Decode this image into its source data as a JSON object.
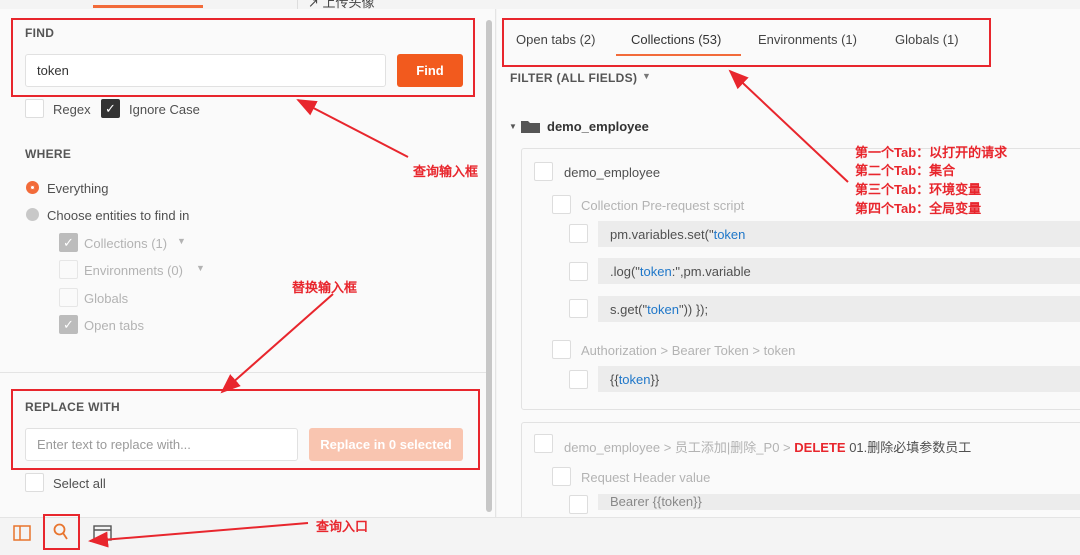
{
  "top_clip": "↗ 上传头像",
  "find": {
    "title": "FIND",
    "value": "token",
    "button": "Find",
    "regex": "Regex",
    "ignore_case": "Ignore Case"
  },
  "where": {
    "title": "WHERE",
    "everything": "Everything",
    "choose": "Choose entities to find in",
    "collections": "Collections (1)",
    "environments": "Environments (0)",
    "globals": "Globals",
    "open_tabs": "Open tabs"
  },
  "replace": {
    "title": "REPLACE WITH",
    "placeholder": "Enter text to replace with...",
    "button": "Replace in 0 selected",
    "select_all": "Select all"
  },
  "tabs": {
    "open_tabs": "Open tabs (2)",
    "collections": "Collections (53)",
    "environments": "Environments (1)",
    "globals": "Globals (1)"
  },
  "filter": "FILTER (ALL FIELDS)",
  "results": {
    "folder": "demo_employee",
    "card1_title": "demo_employee",
    "pre_request": "Collection Pre-request script",
    "code1_a": "pm.variables.set(\"",
    "code1_b": "token",
    "code2_a": ".log(\"",
    "code2_b": "token",
    "code2_c": ":\",pm.variable",
    "code3_a": "s.get(\"",
    "code3_b": "token",
    "code3_c": "\")) });",
    "authorization": "Authorization > Bearer Token > token",
    "code4_a": "{{",
    "code4_b": "token",
    "code4_c": "}}",
    "card2_path": "demo_employee > 员工添加|删除_P0 >",
    "card2_method": "DELETE",
    "card2_name": "01.删除必填参数员工",
    "request_header": "Request Header value",
    "code5": "Bearer {{token}}"
  },
  "annotations": {
    "find_box": "查询输入框",
    "replace_box": "替换输入框",
    "entry": "查询入口",
    "tab1": "第一个Tab：以打开的请求",
    "tab2": "第二个Tab：集合",
    "tab3": "第三个Tab：环境变量",
    "tab4": "第四个Tab：全局变量"
  },
  "colors": {
    "accent": "#f26b3a",
    "annotation": "#e8262d",
    "keyword": "#1f77c9"
  }
}
